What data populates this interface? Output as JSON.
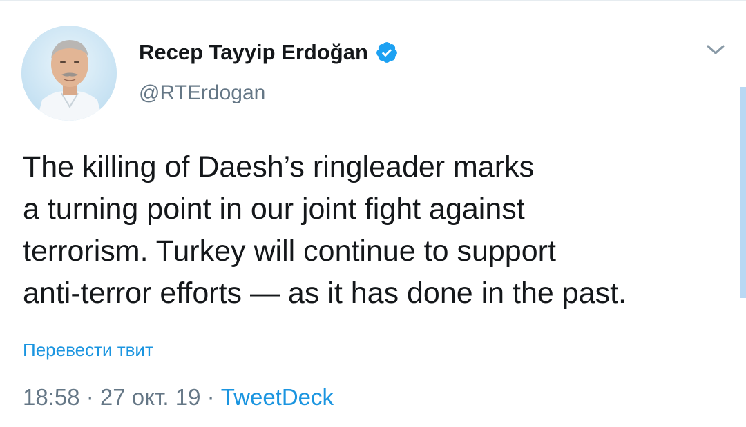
{
  "tweet": {
    "author": {
      "display_name": "Recep Tayyip Erdoğan",
      "handle": "@RTErdogan",
      "verified": true,
      "avatar_icon": "profile-photo"
    },
    "menu_icon": "chevron-down-icon",
    "text": "The killing of Daesh’s ringleader marks\na turning point in our joint fight against\nterrorism. Turkey will continue to support\nanti-terror efforts — as it has done in the past.",
    "translate_label": "Перевести твит",
    "time": "18:58",
    "separator": " · ",
    "date": "27 окт. 19",
    "source": "TweetDeck"
  },
  "colors": {
    "text": "#14171a",
    "secondary": "#657786",
    "link": "#1b95e0",
    "verified": "#1da1f2",
    "scrollbar": "#b9d8f3"
  }
}
